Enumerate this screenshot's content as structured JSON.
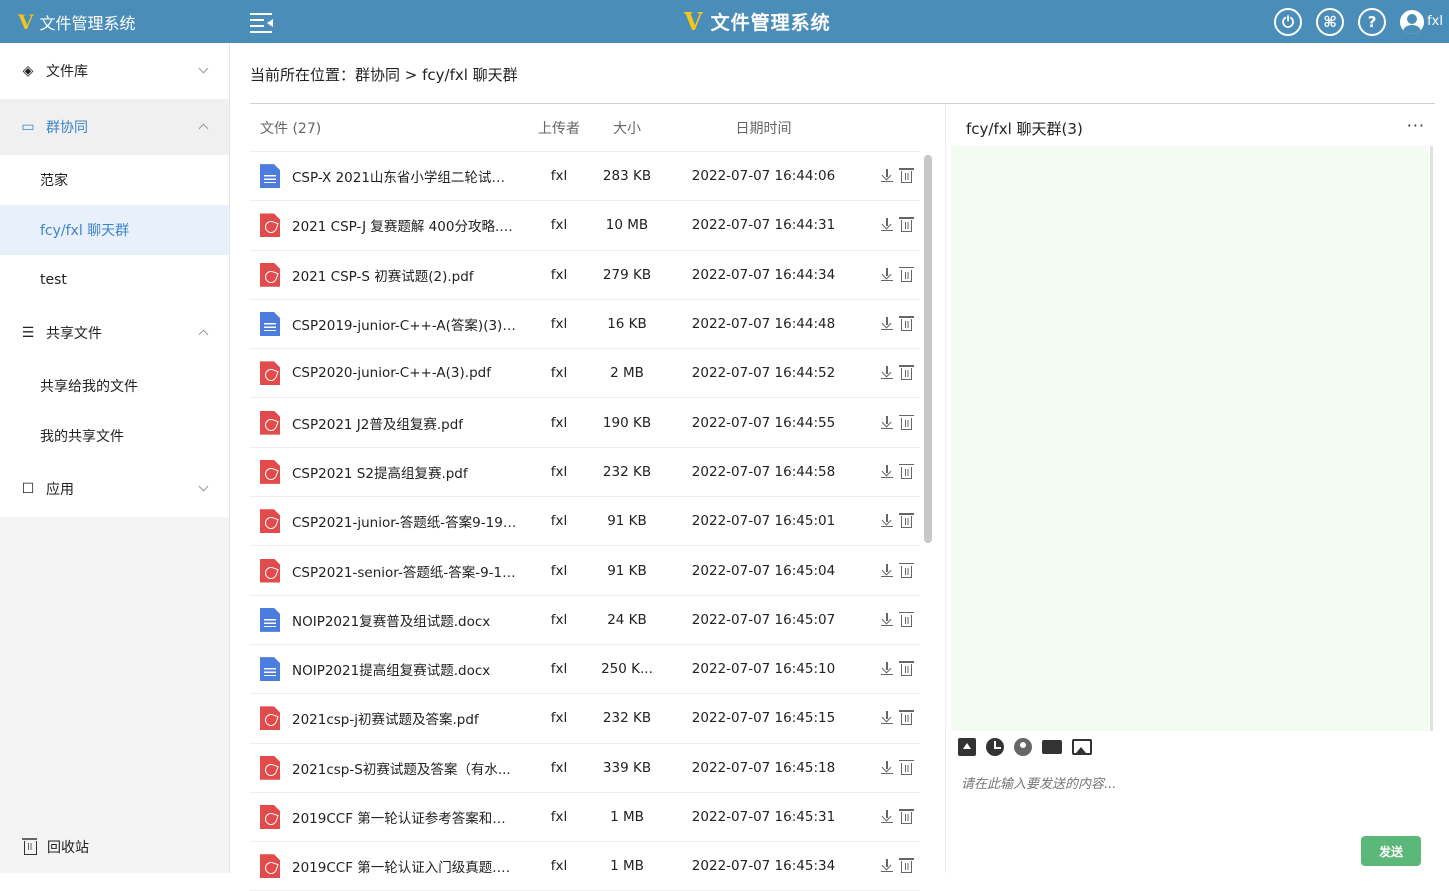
{
  "app": {
    "title": "文件管理系统",
    "logo": "V",
    "user": "fxl"
  },
  "sidebar": {
    "groups": [
      {
        "label": "文件库",
        "icon": "layers-icon",
        "expanded": false
      },
      {
        "label": "群协同",
        "icon": "chat-group-icon",
        "expanded": true,
        "items": [
          "范家",
          "fcy/fxl 聊天群",
          "test"
        ]
      },
      {
        "label": "共享文件",
        "icon": "share-file-icon",
        "expanded": true,
        "items": [
          "共享给我的文件",
          "我的共享文件"
        ]
      },
      {
        "label": "应用",
        "icon": "app-icon",
        "expanded": false
      }
    ],
    "recycle": "回收站"
  },
  "breadcrumb": "当前所在位置：群协同 > fcy/fxl 聊天群",
  "file_list": {
    "headers": {
      "name": "文件 (27)",
      "uploader": "上传者",
      "size": "大小",
      "date": "日期时间"
    },
    "rows": [
      {
        "type": "doc",
        "name": "CSP-X 2021山东省小学组二轮试题...",
        "uploader": "fxl",
        "size": "283 KB",
        "date": "2022-07-07 16:44:06"
      },
      {
        "type": "pdf",
        "name": "2021 CSP-J 复赛题解 400分攻略.p...",
        "uploader": "fxl",
        "size": "10 MB",
        "date": "2022-07-07 16:44:31"
      },
      {
        "type": "pdf",
        "name": "2021 CSP-S 初赛试题(2).pdf",
        "uploader": "fxl",
        "size": "279 KB",
        "date": "2022-07-07 16:44:34"
      },
      {
        "type": "doc",
        "name": "CSP2019-junior-C++-A(答案)(3).d...",
        "uploader": "fxl",
        "size": "16 KB",
        "date": "2022-07-07 16:44:48"
      },
      {
        "type": "pdf",
        "name": "CSP2020-junior-C++-A(3).pdf",
        "uploader": "fxl",
        "size": "2 MB",
        "date": "2022-07-07 16:44:52"
      },
      {
        "type": "pdf",
        "name": "CSP2021 J2普及组复赛.pdf",
        "uploader": "fxl",
        "size": "190 KB",
        "date": "2022-07-07 16:44:55"
      },
      {
        "type": "pdf",
        "name": "CSP2021 S2提高组复赛.pdf",
        "uploader": "fxl",
        "size": "232 KB",
        "date": "2022-07-07 16:44:58"
      },
      {
        "type": "pdf",
        "name": "CSP2021-junior-答题纸-答案9-19.p...",
        "uploader": "fxl",
        "size": "91 KB",
        "date": "2022-07-07 16:45:01"
      },
      {
        "type": "pdf",
        "name": "CSP2021-senior-答题纸-答案-9-19...",
        "uploader": "fxl",
        "size": "91 KB",
        "date": "2022-07-07 16:45:04"
      },
      {
        "type": "doc",
        "name": "NOIP2021复赛普及组试题.docx",
        "uploader": "fxl",
        "size": "24 KB",
        "date": "2022-07-07 16:45:07"
      },
      {
        "type": "doc",
        "name": "NOIP2021提高组复赛试题.docx",
        "uploader": "fxl",
        "size": "250 K...",
        "date": "2022-07-07 16:45:10"
      },
      {
        "type": "pdf",
        "name": "2021csp-j初赛试题及答案.pdf",
        "uploader": "fxl",
        "size": "232 KB",
        "date": "2022-07-07 16:45:15"
      },
      {
        "type": "pdf",
        "name": "2021csp-S初赛试题及答案（有水...",
        "uploader": "fxl",
        "size": "339 KB",
        "date": "2022-07-07 16:45:18"
      },
      {
        "type": "pdf",
        "name": "2019CCF 第一轮认证参考答案和分...",
        "uploader": "fxl",
        "size": "1 MB",
        "date": "2022-07-07 16:45:31"
      },
      {
        "type": "pdf",
        "name": "2019CCF 第一轮认证入门级真题.p...",
        "uploader": "fxl",
        "size": "1 MB",
        "date": "2022-07-07 16:45:34"
      }
    ]
  },
  "chat": {
    "title": "fcy/fxl 聊天群(3)",
    "more": "···",
    "input_placeholder": "请在此输入要发送的内容...",
    "send_label": "发送"
  }
}
